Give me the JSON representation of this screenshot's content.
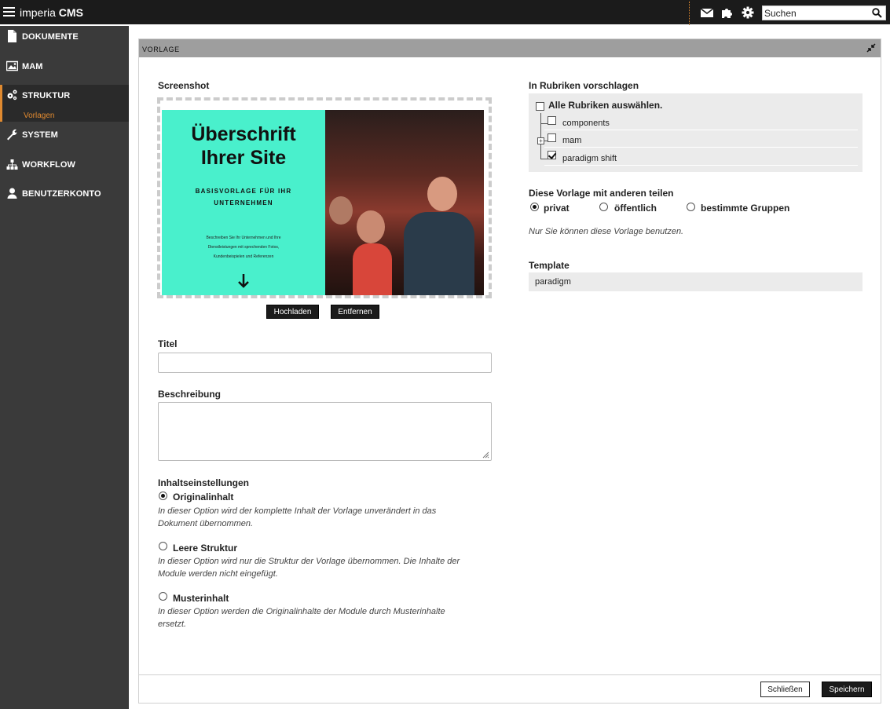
{
  "topbar": {
    "app_name_light": "imperia",
    "app_name_bold": "CMS",
    "search_placeholder": "Suchen",
    "icons": [
      "menu-icon",
      "mail-icon",
      "puzzle-icon",
      "gear-icon",
      "search-icon"
    ],
    "accent_color": "#e08a30"
  },
  "sidebar": {
    "items": [
      {
        "label": "DOKUMENTE",
        "icon": "document-icon"
      },
      {
        "label": "MAM",
        "icon": "image-icon"
      },
      {
        "label": "STRUKTUR",
        "icon": "gears-icon",
        "sub": "Vorlagen"
      },
      {
        "label": "SYSTEM",
        "icon": "wrench-icon"
      },
      {
        "label": "WORKFLOW",
        "icon": "sitemap-icon"
      },
      {
        "label": "BENUTZERKONTO",
        "icon": "user-icon"
      }
    ]
  },
  "panel": {
    "title": "VORLAGE",
    "screenshot": {
      "label": "Screenshot",
      "preview_heading_1": "Überschrift",
      "preview_heading_2": "Ihrer Site",
      "preview_sub_1": "BASISVORLAGE FÜR IHR",
      "preview_sub_2": "UNTERNEHMEN",
      "preview_small_1": "Beschreiben Sie Ihr Unternehmen und Ihre",
      "preview_small_2": "Dienstleistungen mit sprechenden Fotos,",
      "preview_small_3": "Kundenbeispielen und Referenzen",
      "upload_button": "Hochladen",
      "remove_button": "Entfernen"
    },
    "title_field": {
      "label": "Titel",
      "value": ""
    },
    "description_field": {
      "label": "Beschreibung",
      "value": ""
    },
    "content_settings": {
      "label": "Inhaltseinstellungen",
      "options": [
        {
          "label": "Originalinhalt",
          "selected": true,
          "desc_1": "In dieser Option wird der komplette Inhalt der Vorlage unverändert in das",
          "desc_2": "Dokument übernommen."
        },
        {
          "label": "Leere Struktur",
          "selected": false,
          "desc_1": "In dieser Option wird nur die Struktur der Vorlage übernommen. Die Inhalte der",
          "desc_2": "Module werden nicht eingefügt."
        },
        {
          "label": "Musterinhalt",
          "selected": false,
          "desc_1": "In dieser Option werden die Originalinhalte der Module durch Musterinhalte",
          "desc_2": "ersetzt."
        }
      ]
    },
    "categories": {
      "label": "In Rubriken vorschlagen",
      "select_all": "Alle Rubriken auswählen.",
      "items": [
        {
          "label": "components",
          "checked": false
        },
        {
          "label": "mam",
          "checked": false,
          "expandable": true
        },
        {
          "label": "paradigm shift",
          "checked": true
        }
      ]
    },
    "sharing": {
      "label": "Diese Vorlage mit anderen teilen",
      "options": [
        {
          "label": "privat",
          "selected": true
        },
        {
          "label": "öffentlich",
          "selected": false
        },
        {
          "label": "bestimmte Gruppen",
          "selected": false
        }
      ],
      "hint": "Nur Sie können diese Vorlage benutzen."
    },
    "template": {
      "label": "Template",
      "value": "paradigm"
    },
    "footer": {
      "close_button": "Schließen",
      "save_button": "Speichern"
    }
  }
}
